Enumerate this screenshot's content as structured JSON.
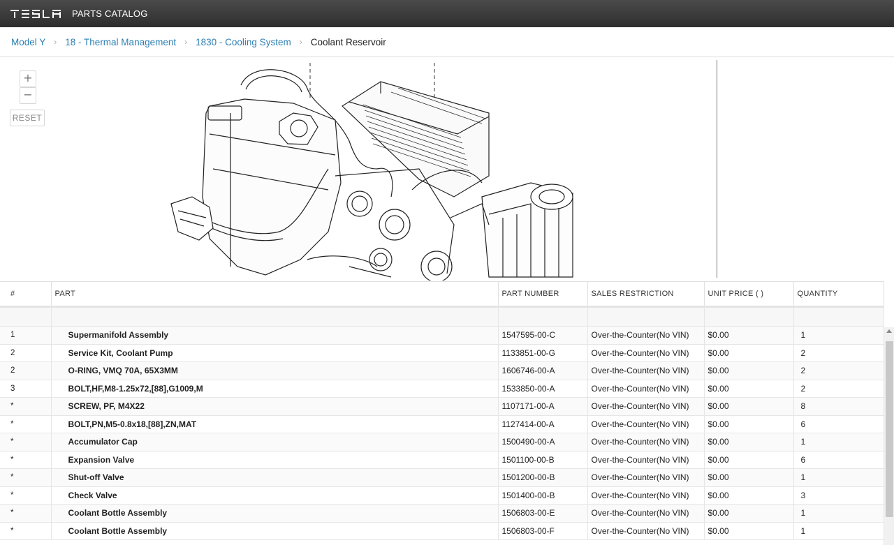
{
  "header": {
    "logo": "TESLA",
    "app_title": "PARTS CATALOG"
  },
  "breadcrumb": {
    "items": [
      "Model Y",
      "18 - Thermal Management",
      "1830 - Cooling System"
    ],
    "current": "Coolant Reservoir",
    "separator": "›"
  },
  "diagram": {
    "zoom_in": "+",
    "zoom_out": "−",
    "reset": "RESET"
  },
  "table": {
    "columns": [
      "#",
      "PART",
      "PART NUMBER",
      "SALES RESTRICTION",
      "UNIT PRICE ( )",
      "QUANTITY"
    ],
    "rows": [
      {
        "num": "1",
        "part": "Supermanifold Assembly",
        "part_number": "1547595-00-C",
        "restriction": "Over-the-Counter(No VIN)",
        "price": "$0.00",
        "qty": "1"
      },
      {
        "num": "2",
        "part": "Service Kit, Coolant Pump",
        "part_number": "1133851-00-G",
        "restriction": "Over-the-Counter(No VIN)",
        "price": "$0.00",
        "qty": "2"
      },
      {
        "num": "2",
        "part": "O-RING, VMQ 70A, 65X3MM",
        "part_number": "1606746-00-A",
        "restriction": "Over-the-Counter(No VIN)",
        "price": "$0.00",
        "qty": "2"
      },
      {
        "num": "3",
        "part": "BOLT,HF,M8-1.25x72,[88],G1009,M",
        "part_number": "1533850-00-A",
        "restriction": "Over-the-Counter(No VIN)",
        "price": "$0.00",
        "qty": "2"
      },
      {
        "num": "*",
        "part": "SCREW, PF, M4X22",
        "part_number": "1107171-00-A",
        "restriction": "Over-the-Counter(No VIN)",
        "price": "$0.00",
        "qty": "8"
      },
      {
        "num": "*",
        "part": "BOLT,PN,M5-0.8x18,[88],ZN,MAT",
        "part_number": "1127414-00-A",
        "restriction": "Over-the-Counter(No VIN)",
        "price": "$0.00",
        "qty": "6"
      },
      {
        "num": "*",
        "part": "Accumulator Cap",
        "part_number": "1500490-00-A",
        "restriction": "Over-the-Counter(No VIN)",
        "price": "$0.00",
        "qty": "1"
      },
      {
        "num": "*",
        "part": "Expansion Valve",
        "part_number": "1501100-00-B",
        "restriction": "Over-the-Counter(No VIN)",
        "price": "$0.00",
        "qty": "6"
      },
      {
        "num": "*",
        "part": "Shut-off Valve",
        "part_number": "1501200-00-B",
        "restriction": "Over-the-Counter(No VIN)",
        "price": "$0.00",
        "qty": "1"
      },
      {
        "num": "*",
        "part": "Check Valve",
        "part_number": "1501400-00-B",
        "restriction": "Over-the-Counter(No VIN)",
        "price": "$0.00",
        "qty": "3"
      },
      {
        "num": "*",
        "part": "Coolant Bottle Assembly",
        "part_number": "1506803-00-E",
        "restriction": "Over-the-Counter(No VIN)",
        "price": "$0.00",
        "qty": "1"
      },
      {
        "num": "*",
        "part": "Coolant Bottle Assembly",
        "part_number": "1506803-00-F",
        "restriction": "Over-the-Counter(No VIN)",
        "price": "$0.00",
        "qty": "1"
      }
    ]
  }
}
